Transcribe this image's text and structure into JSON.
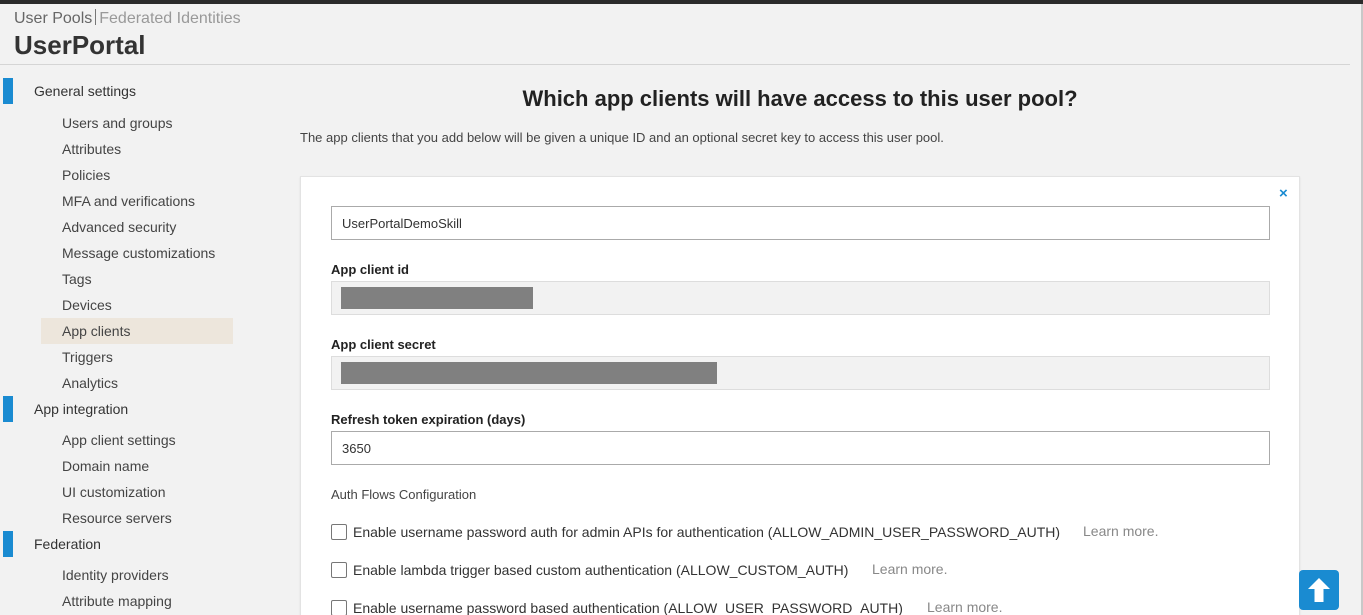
{
  "header": {
    "tabs": [
      "User Pools",
      "Federated Identities"
    ],
    "pool_name": "UserPortal"
  },
  "sidebar": {
    "sections": [
      {
        "label": "General settings",
        "items": [
          "Users and groups",
          "Attributes",
          "Policies",
          "MFA and verifications",
          "Advanced security",
          "Message customizations",
          "Tags",
          "Devices",
          "App clients",
          "Triggers",
          "Analytics"
        ]
      },
      {
        "label": "App integration",
        "items": [
          "App client settings",
          "Domain name",
          "UI customization",
          "Resource servers"
        ]
      },
      {
        "label": "Federation",
        "items": [
          "Identity providers",
          "Attribute mapping"
        ]
      }
    ],
    "active_item": "App clients"
  },
  "main": {
    "heading": "Which app clients will have access to this user pool?",
    "description": "The app clients that you add below will be given a unique ID and an optional secret key to access this user pool.",
    "close_glyph": "×",
    "client_name": "UserPortalDemoSkill",
    "client_id_label": "App client id",
    "client_secret_label": "App client secret",
    "refresh_label": "Refresh token expiration (days)",
    "refresh_value": "3650",
    "auth_flows_label": "Auth Flows Configuration",
    "auth_flows": [
      {
        "label": "Enable username password auth for admin APIs for authentication (ALLOW_ADMIN_USER_PASSWORD_AUTH)",
        "checked": false,
        "link": "Learn more."
      },
      {
        "label": "Enable lambda trigger based custom authentication (ALLOW_CUSTOM_AUTH)",
        "checked": false,
        "link": "Learn more."
      },
      {
        "label": "Enable username password based authentication (ALLOW_USER_PASSWORD_AUTH)",
        "checked": false,
        "link": "Learn more."
      }
    ]
  },
  "colors": {
    "accent": "#1a8bd1",
    "active_bg": "#ede6dc",
    "redaction": "#808080"
  },
  "icons": {
    "scroll_top": "arrow-up-icon",
    "close": "close-icon"
  }
}
